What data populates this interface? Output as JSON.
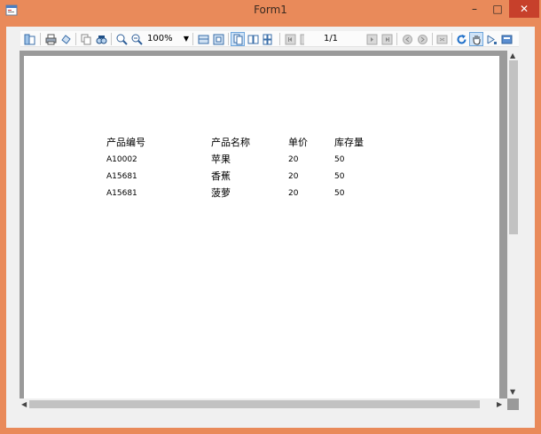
{
  "window": {
    "title": "Form1",
    "buttons": {
      "minimize": "–",
      "maximize": "□",
      "close": "✕"
    },
    "colors": {
      "frame": "#e98a5a",
      "close": "#c7402b",
      "client": "#f0f0f0"
    }
  },
  "toolbar": {
    "zoom": "100%",
    "page_indicator": "1/1",
    "buttons": [
      "document-map-icon",
      "print-icon",
      "page-setup-icon",
      "copy-icon",
      "find-icon",
      "zoom-in-icon",
      "zoom-out-icon",
      "one-page-icon",
      "whole-page-icon",
      "single-page-view-icon",
      "multi-page-view-icon",
      "multiple-pages-dropdown-icon",
      "first-page-icon",
      "previous-page-icon",
      "next-page-icon",
      "last-page-icon",
      "back-icon",
      "forward-icon",
      "refresh-icon",
      "hand-tool-icon",
      "annotations-icon",
      "export-icon"
    ]
  },
  "report": {
    "headers": [
      "产品编号",
      "产品名称",
      "单价",
      "库存量"
    ],
    "rows": [
      [
        "A10002",
        "苹果",
        "20",
        "50"
      ],
      [
        "A15681",
        "香蕉",
        "20",
        "50"
      ],
      [
        "A15681",
        "菠萝",
        "20",
        "50"
      ]
    ]
  }
}
